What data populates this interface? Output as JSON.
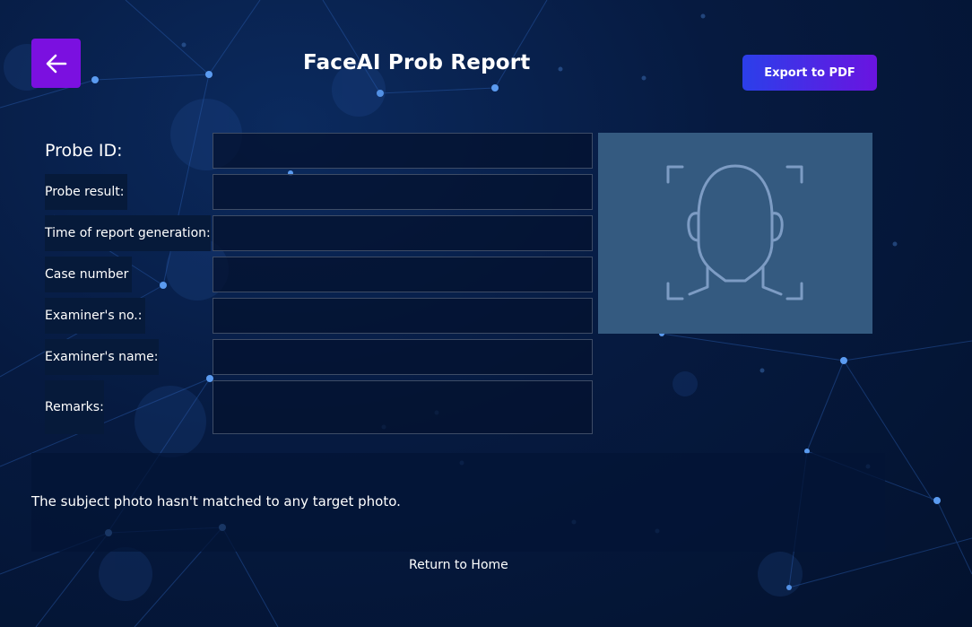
{
  "header": {
    "title": "FaceAI Prob Report",
    "back_icon": "arrow-left-icon",
    "export_label": "Export to PDF"
  },
  "form": {
    "fields": [
      {
        "label": "Probe ID:",
        "value": ""
      },
      {
        "label": "Probe result:",
        "value": ""
      },
      {
        "label": "Time of report generation:",
        "value": ""
      },
      {
        "label": "Case number",
        "value": ""
      },
      {
        "label": "Examiner's no.:",
        "value": ""
      },
      {
        "label": "Examiner's name:",
        "value": ""
      },
      {
        "label": "Remarks:",
        "value": ""
      }
    ]
  },
  "photo": {
    "icon": "face-scan-icon"
  },
  "result": {
    "message": "The subject photo hasn't matched to any target photo."
  },
  "footer": {
    "home_link": "Return to Home"
  },
  "colors": {
    "background": "#061a40",
    "accent_purple": "#7b10e0",
    "export_gradient_start": "#2b3fea",
    "export_gradient_end": "#6a14e0",
    "photo_panel": "#345a80",
    "face_icon_stroke": "#7d9cc4",
    "network_dots": "#5b9bf0"
  }
}
